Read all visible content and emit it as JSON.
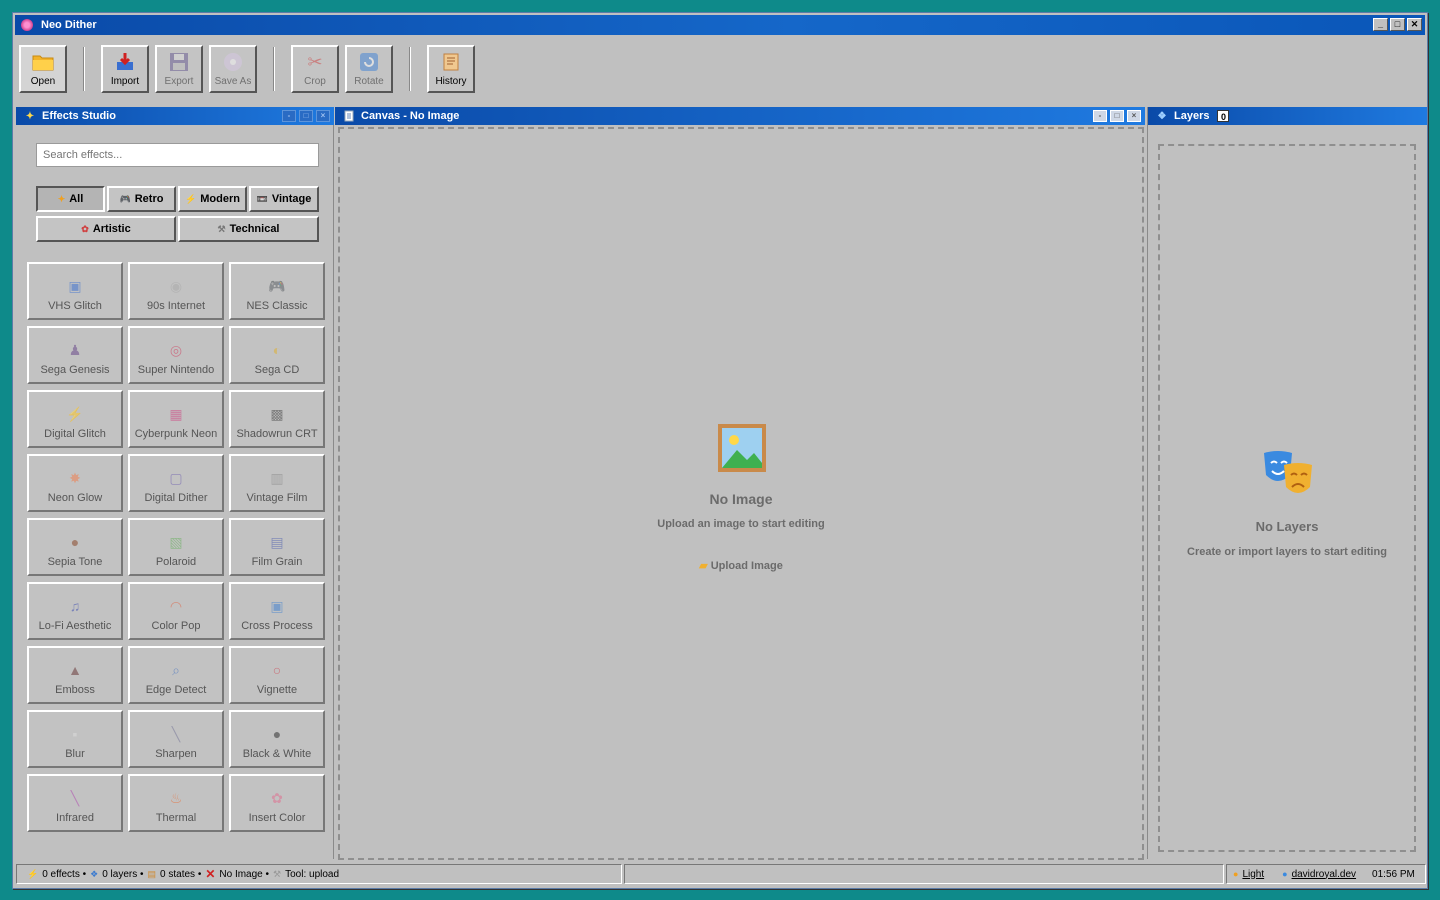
{
  "window": {
    "title": "Neo Dither",
    "controls": [
      "_",
      "□",
      "✕"
    ]
  },
  "toolbar": {
    "buttons": [
      {
        "label": "Open",
        "icon": "folder-icon"
      },
      {
        "label": "Import",
        "icon": "import-icon"
      },
      {
        "label": "Export",
        "icon": "save-icon"
      },
      {
        "label": "Save As",
        "icon": "disc-icon"
      },
      {
        "label": "Crop",
        "icon": "scissors-icon"
      },
      {
        "label": "Rotate",
        "icon": "rotate-icon"
      },
      {
        "label": "History",
        "icon": "scroll-icon"
      }
    ]
  },
  "effects_panel": {
    "title": "Effects Studio",
    "search_placeholder": "Search effects...",
    "categories": [
      {
        "label": "All",
        "icon": "star-icon"
      },
      {
        "label": "Retro",
        "icon": "gamepad-icon"
      },
      {
        "label": "Modern",
        "icon": "bolt-icon"
      },
      {
        "label": "Vintage",
        "icon": "film-icon"
      },
      {
        "label": "Artistic",
        "icon": "palette-icon"
      },
      {
        "label": "Technical",
        "icon": "wrench-icon"
      }
    ],
    "effects": [
      "VHS Glitch",
      "90s Internet",
      "NES Classic",
      "Sega Genesis",
      "Super Nintendo",
      "Sega CD",
      "Digital Glitch",
      "Cyberpunk Neon",
      "Shadowrun CRT",
      "Neon Glow",
      "Digital Dither",
      "Vintage Film",
      "Sepia Tone",
      "Polaroid",
      "Film Grain",
      "Lo-Fi Aesthetic",
      "Color Pop",
      "Cross Process",
      "Emboss",
      "Edge Detect",
      "Vignette",
      "Blur",
      "Sharpen",
      "Black & White",
      "Infrared",
      "Thermal",
      "Insert Color"
    ]
  },
  "canvas": {
    "title": "Canvas - No Image",
    "empty_title": "No Image",
    "empty_subtitle": "Upload an image to start editing",
    "upload_label": "Upload Image"
  },
  "layers_panel": {
    "title": "Layers",
    "count": "0",
    "empty_title": "No Layers",
    "empty_subtitle": "Create or import layers to start editing"
  },
  "statusbar": {
    "effects": "0 effects •",
    "layers": "0 layers •",
    "states": "0 states •",
    "image": "No Image •",
    "tool": "Tool: upload",
    "theme": "Light",
    "site": "davidroyal.dev",
    "time": "01:56 PM"
  },
  "colors": {
    "desktop": "#0e8a8a",
    "titlebar": "#0a4aa8",
    "window": "#c0c0c0"
  }
}
